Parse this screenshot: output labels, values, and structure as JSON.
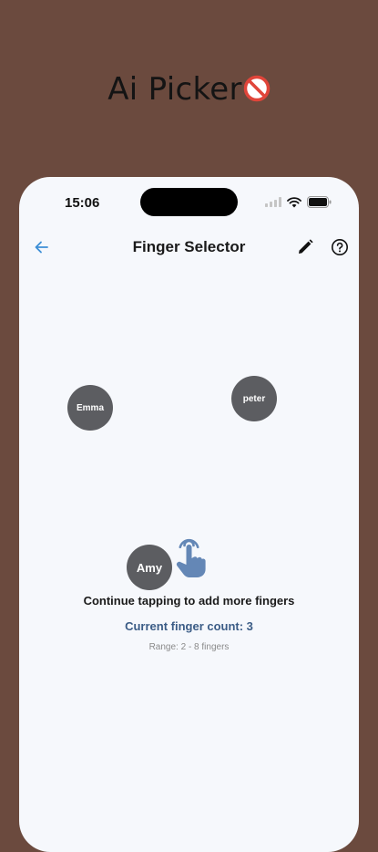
{
  "promo": {
    "title": "Ai Picker",
    "title_icon": "prohibited-icon"
  },
  "status_bar": {
    "time": "15:06",
    "icons": [
      "cellular-signal-icon",
      "wifi-icon",
      "battery-icon"
    ]
  },
  "nav": {
    "title": "Finger Selector",
    "back_icon": "back-arrow-icon",
    "edit_icon": "pencil-icon",
    "help_icon": "help-circle-icon"
  },
  "fingers": [
    {
      "name": "Emma"
    },
    {
      "name": "peter"
    },
    {
      "name": "Amy"
    }
  ],
  "instructions": {
    "hint": "Continue tapping to add more fingers",
    "count": "Current finger count: 3",
    "range": "Range: 2 - 8 fingers"
  },
  "colors": {
    "background": "#6b4a3e",
    "screen": "#f6f8fc",
    "finger_circle": "#5c5d61",
    "accent": "#3b5c86",
    "back_arrow": "#3d8fd6",
    "hand_icon": "#6487b6"
  }
}
